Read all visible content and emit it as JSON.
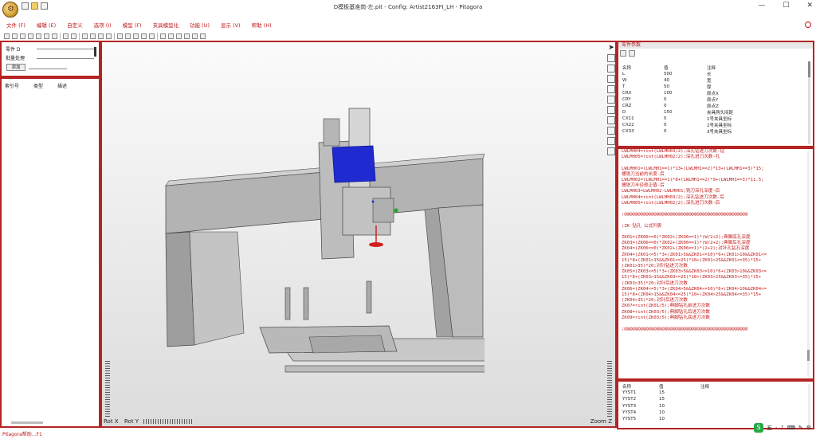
{
  "window": {
    "title": "D模板基准岗-左.pit - Config: Artist2163FI_LH - Pitagora",
    "minimize": "—",
    "maximize": "☐",
    "close": "✕"
  },
  "app_icon": {
    "glyph": "⚙",
    "name": "pitagora-app-icon"
  },
  "menu": [
    "文件 (F)",
    "编辑 (E)",
    "自定义",
    "选项 (I)",
    "模型 (F)",
    "夹具模型化",
    "功能 (U)",
    "显示 (V)",
    "帮助 (H)"
  ],
  "left_top": {
    "row1": "零件 D",
    "row2": "批量处理",
    "button": "添加"
  },
  "left_list": {
    "columns": [
      "索引号",
      "类型",
      "描述"
    ]
  },
  "viewport": {
    "rot_x": "Rot X",
    "rot_y": "Rot Y",
    "zoom_z": "Zoom Z"
  },
  "right_top": {
    "tab": "零件参数",
    "columns": [
      "名称",
      "值",
      "注释"
    ],
    "rows": [
      [
        "L",
        "500",
        "长"
      ],
      [
        "W",
        "40",
        "宽"
      ],
      [
        "T",
        "50",
        "厚"
      ],
      [
        "CRX",
        "100",
        "原点X"
      ],
      [
        "CRY",
        "0",
        "原点Y"
      ],
      [
        "CRZ",
        "0",
        "原点Z"
      ],
      [
        "D",
        "150",
        "夹具两头间距"
      ],
      [
        "CX11",
        "0",
        "1号夹具坐标"
      ],
      [
        "CX22",
        "0",
        "2号夹具坐标"
      ],
      [
        "CX33",
        "0",
        "3号夹具坐标"
      ]
    ]
  },
  "code_lines": [
    "LWLMH04=rint(LWLMH03/2);深孔钻进刀次数-钻",
    "LWLMH05=rint(LWLMH02/2);深孔进刀次数-孔",
    "",
    "LWLMH01=(LWLMH1==1)*13+(LWLMH1==2)*13+(LWLMH1==3)*15;",
    "槽铣刀当前的长度-后",
    "LWLMH02=(LWLMH1==1)*8+(LWLMH1==2)*9+(LWLMH1==3)*11.5;",
    "槽铣刀半径修正值-后",
    "LWLMH03=LWLMH02-LWLMH01;铣刀深孔深度-后",
    "LWLMH04=rint(LWLMH03/2);深孔钻进刀次数-后",
    "LWLMH05=rint(LWLMH02/2);深孔进刀次数-后",
    "",
    ";@@@@@@@@@@@@@@@@@@@@@@@@@@@@@@@@@@@@@@@@@@@@@@",
    "",
    ";ZK 钻孔 公式列表",
    "",
    "ZK01=(ZK06==0)*ZK02+(ZK06==1)*(W/2+2);典脚底孔深度",
    "ZK03=(ZK06==0)*ZK02+(ZK06==1)*(W/2+2);典脚后孔深度",
    "ZK04=(ZK06==0)*ZK02+(ZK06==1)*(2+2);对针孔钻孔深度",
    "ZK04=(ZK01<=5)*3+(ZK01>5&&ZK01<=10)*6+(ZK01>10&&ZK01<=",
    "15)*8+(ZK01>15&&ZK01<=25)*10+(ZK01>25&&ZK01<=35)*15+",
    "(ZK01>35)*20;对针钻进刀次数",
    "ZK05=(ZK03<=5)*3+(ZK03>5&&ZK03<=10)*6+(ZK03>10&&ZK03<=",
    "15)*8+(ZK03>15&&ZK03<=25)*10+(ZK03>25&&ZK03<=35)*15+",
    "(ZK03>35)*20;对针后进刀次数",
    "ZK06=(ZK04<=5)*3+(ZK04>5&&ZK04<=10)*6+(ZK04>10&&ZK04<=",
    "15)*8+(ZK04>15&&ZK04<=25)*10+(ZK04>25&&ZK04<=35)*15+",
    "(ZK04>35)*20;对针后进刀次数",
    "ZK07=rint(ZK01/5);典脚钻孔前进刀次数",
    "ZK08=rint(ZK03/5);典脚钻孔后进刀次数",
    "ZK09=rint(ZK03/5);典脚钻孔底进刀次数",
    "",
    ";@@@@@@@@@@@@@@@@@@@@@@@@@@@@@@@@@@@@@@@@@@@@@@"
  ],
  "right_bottom": {
    "columns": [
      "名称",
      "值",
      "注释"
    ],
    "rows": [
      [
        "YYST1",
        "15",
        ""
      ],
      [
        "YYST2",
        "15",
        ""
      ],
      [
        "YYST3",
        "10",
        ""
      ],
      [
        "YYST4",
        "10",
        ""
      ],
      [
        "YYST5",
        "10",
        ""
      ]
    ]
  },
  "status": {
    "text": "Pitagora帮助...F1",
    "tray": [
      "五",
      "·",
      "♪",
      "⌨",
      "✎",
      "⚙"
    ]
  }
}
